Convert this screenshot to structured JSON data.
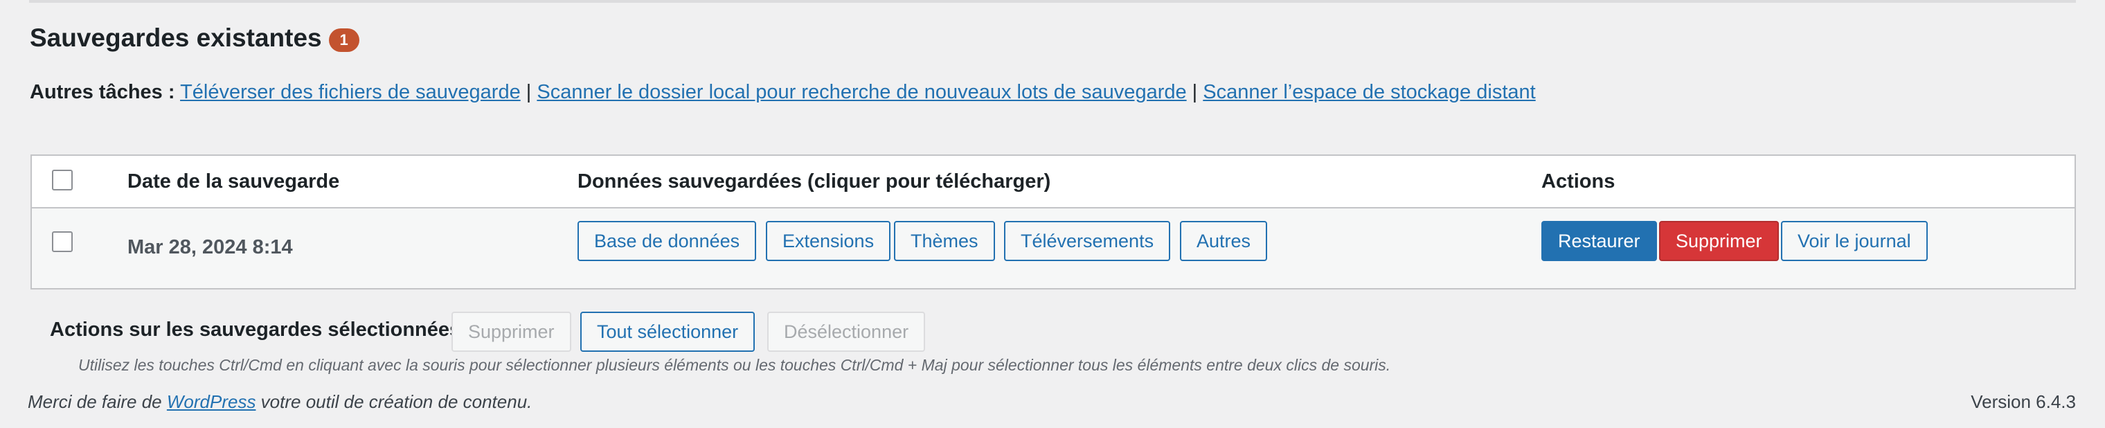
{
  "section": {
    "title": "Sauvegardes existantes",
    "count": "1"
  },
  "other_tasks": {
    "label": "Autres tâches :",
    "separator": " | ",
    "links": [
      "Téléverser des fichiers de sauvegarde",
      "Scanner le dossier local pour recherche de nouveaux lots de sauvegarde",
      "Scanner l’espace de stockage distant"
    ]
  },
  "table": {
    "headers": {
      "date": "Date de la sauvegarde",
      "data": "Données sauvegardées (cliquer pour télécharger)",
      "actions": "Actions"
    },
    "rows": [
      {
        "selected": false,
        "date": "Mar 28, 2024 8:14",
        "data_buttons": [
          "Base de données",
          "Extensions",
          "Thèmes",
          "Téléversements",
          "Autres"
        ],
        "actions": {
          "restore": "Restaurer",
          "delete": "Supprimer",
          "view_log": "Voir le journal"
        }
      }
    ]
  },
  "bulk": {
    "label": "Actions sur les sauvegardes sélectionnées",
    "delete": "Supprimer",
    "select_all": "Tout sélectionner",
    "deselect": "Désélectionner",
    "hint": "Utilisez les touches Ctrl/Cmd en cliquant avec la souris pour sélectionner plusieurs éléments ou les touches Ctrl/Cmd + Maj pour sélectionner tous les éléments entre deux clics de souris."
  },
  "footer": {
    "thanks_before": "Merci de faire de ",
    "thanks_link": "WordPress",
    "thanks_after": " votre outil de création de contenu.",
    "version": "Version 6.4.3"
  },
  "colors": {
    "accent": "#2271b1",
    "danger": "#d63638",
    "badge": "#c3532f",
    "background": "#f0f0f1"
  }
}
